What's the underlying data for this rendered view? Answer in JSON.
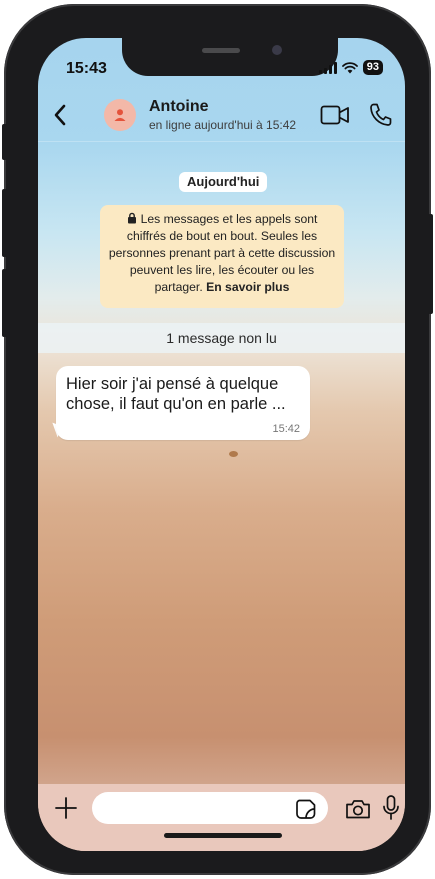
{
  "status_bar": {
    "time": "15:43",
    "battery": "93"
  },
  "header": {
    "contact_name": "Antoine",
    "contact_status": "en ligne aujourd'hui à 15:42"
  },
  "chat": {
    "date_chip": "Aujourd'hui",
    "encryption_notice": "Les messages et les appels sont chiffrés de bout en bout. Seules les personnes prenant part à cette discussion peuvent les lire, les écouter ou les partager.",
    "learn_more": "En savoir plus",
    "unread_banner": "1 message non lu",
    "messages": [
      {
        "text": "Hier soir j'ai pensé à quelque chose, il faut qu'on en parle ...",
        "time": "15:42"
      }
    ]
  },
  "composer": {
    "placeholder": ""
  },
  "icons": {
    "back": "chevron-left-icon",
    "avatar": "person-icon",
    "video": "video-camera-icon",
    "call": "phone-icon",
    "lock": "lock-icon",
    "plus": "plus-icon",
    "sticker": "sticker-icon",
    "camera": "camera-icon",
    "mic": "microphone-icon"
  },
  "colors": {
    "avatar_bg": "#f3b8a8",
    "avatar_icon": "#e4533b",
    "notice_bg": "#fbe9c3",
    "composer_bg": "#e9c8bc"
  }
}
